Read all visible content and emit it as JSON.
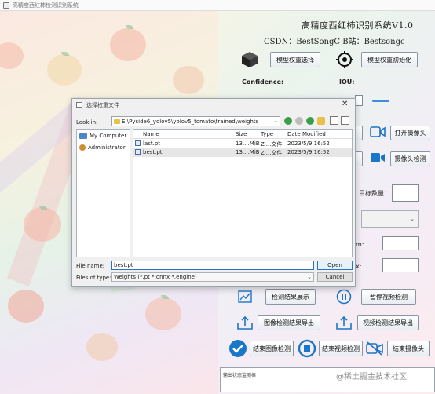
{
  "window": {
    "title": "高精度西红柿检测识别系统"
  },
  "header": {
    "app_title": "高精度西红柿识别系统V1.0",
    "csdn": "CSDN：BestSongC  B站：Bestsongc"
  },
  "controls": {
    "model_select": "模型权重选择",
    "model_init": "模型权重初始化",
    "confidence_label": "Confidence:",
    "iou_label": "IOU:",
    "open_camera": "打开摄像头",
    "camera_detect": "摄像头检测",
    "target_count_label": "目标数量：",
    "partial_m": "m:",
    "partial_x": "x:",
    "result_show": "检测结果展示",
    "pause_video": "暂停视频检测",
    "export_image": "图像检测结果导出",
    "export_video": "视频检测结果导出",
    "end_image": "结束图像检测",
    "end_video": "结束视频检测",
    "end_camera": "结束摄像头"
  },
  "status": {
    "label": "输出状态监测框"
  },
  "watermark": "@稀土掘金技术社区",
  "dialog": {
    "title": "选择权重文件",
    "look_in_label": "Look in:",
    "path": "E:\\Pyside6_yolov5\\yolov5_tomato\\trained\\weights",
    "sidebar": [
      {
        "label": "My Computer"
      },
      {
        "label": "Administrator"
      }
    ],
    "columns": [
      "Name",
      "Size",
      "Type",
      "Date Modified"
    ],
    "files": [
      {
        "name": "last.pt",
        "size": "13....MiB",
        "type": "Zi...文件",
        "date": "2023/5/9 16:52"
      },
      {
        "name": "best.pt",
        "size": "13....MiB",
        "type": "Zi...文件",
        "date": "2023/5/9 16:52"
      }
    ],
    "file_name_label": "File name:",
    "file_name_value": "best.pt",
    "file_type_label": "Files of type:",
    "file_type_value": "Weights (*.pt *.onnx *.engine)",
    "open_button": "Open",
    "cancel_button": "Cancel"
  }
}
